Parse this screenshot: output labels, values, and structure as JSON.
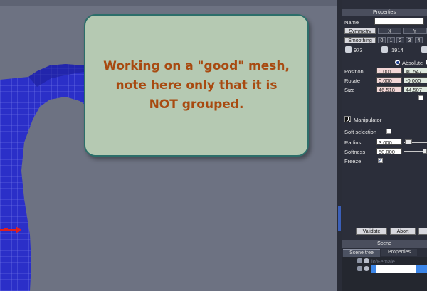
{
  "callout": {
    "line1": "Working on a \"good\" mesh,",
    "line2": "note here only that it is",
    "line3": "NOT grouped."
  },
  "properties": {
    "title": "Properties",
    "name_label": "Name",
    "name_value": "",
    "symmetry_label": "Symmetry",
    "axis_x": "X",
    "axis_y": "Y",
    "smoothing_label": "Smoothing",
    "smoothing_levels": [
      "0",
      "1",
      "2",
      "3",
      "4"
    ],
    "vertex_count": "973",
    "face_count": "1914",
    "absolute_label": "Absolute",
    "position_label": "Position",
    "position_x": "0.001",
    "position_y": "40.547",
    "rotate_label": "Rotate",
    "rotate_x": "0.000",
    "rotate_y": "-0.000",
    "size_label": "Size",
    "size_x": "46.518",
    "size_y": "44.507",
    "manipulator_label": "Manipulator",
    "soft_selection_label": "Soft selection",
    "radius_label": "Radius",
    "radius_value": "3.000",
    "softness_label": "Softness",
    "softness_value": "50.000",
    "freeze_label": "Freeze",
    "freeze_checked": true,
    "validate_label": "Validate",
    "abort_label": "Abort"
  },
  "scene": {
    "title": "Scene",
    "tab_scene_tree": "Scene tree",
    "tab_properties": "Properties",
    "item_female": "lo/Female"
  },
  "colors": {
    "mesh_blue": "#2b2fc8",
    "callout_bg": "#b5c9b2",
    "callout_text": "#a84a10",
    "panel_bg": "#2b2e3a",
    "selection_blue": "#3c86e8"
  }
}
